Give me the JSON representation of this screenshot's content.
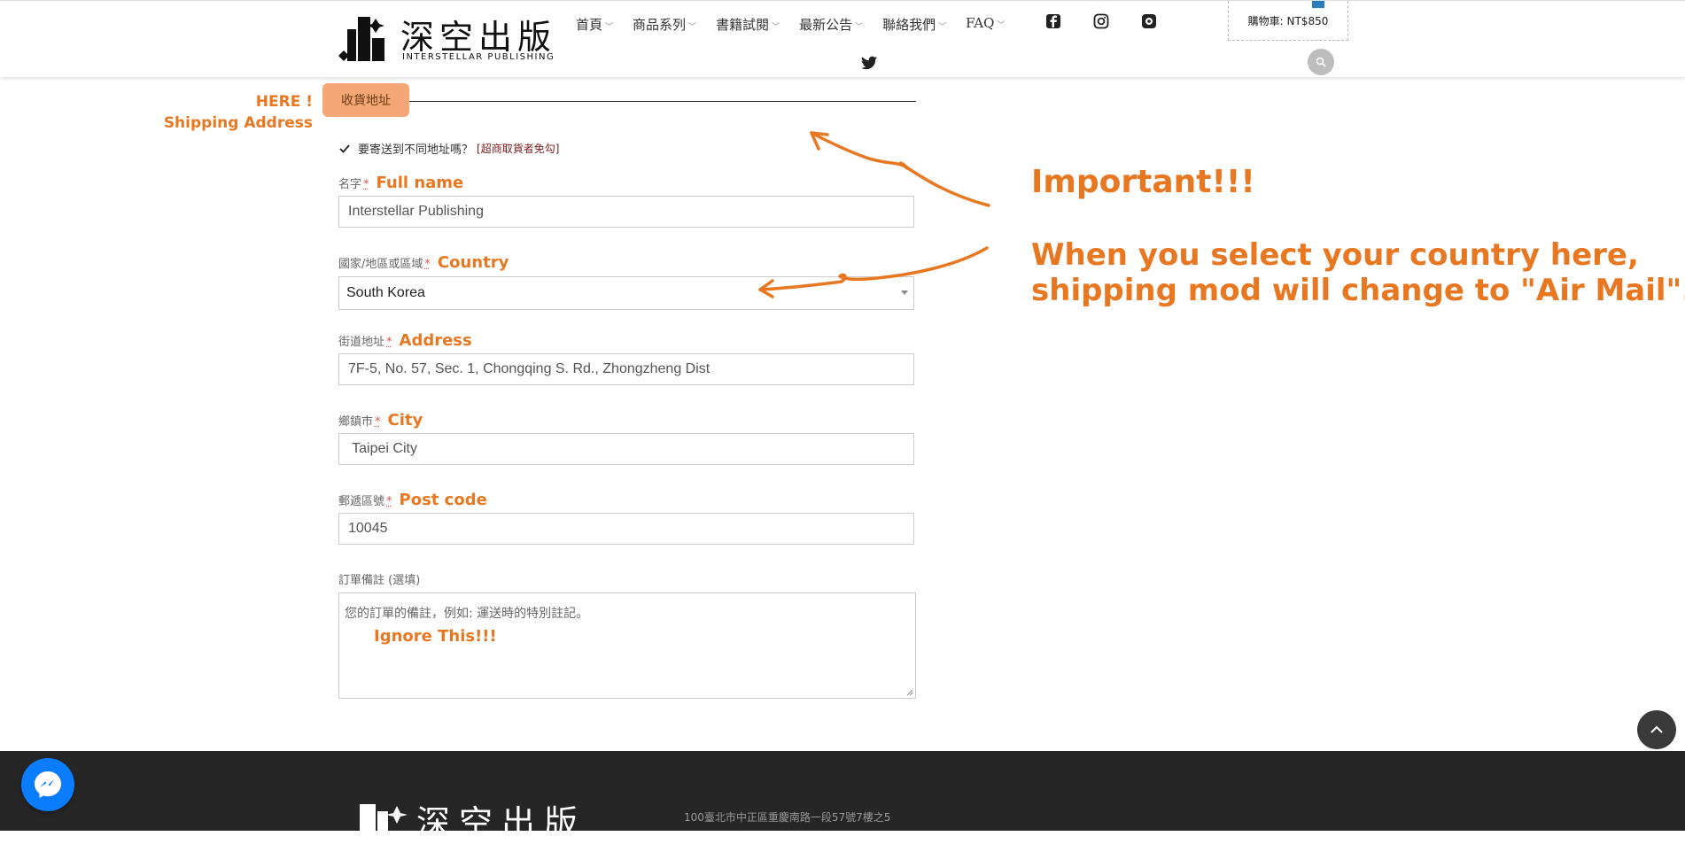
{
  "header": {
    "logo_cn": "深空出版",
    "logo_en": "INTERSTELLAR PUBLISHING",
    "nav": [
      {
        "label": "首頁"
      },
      {
        "label": "商品系列"
      },
      {
        "label": "書籍試閱"
      },
      {
        "label": "最新公告"
      },
      {
        "label": "聯絡我們"
      },
      {
        "label": "FAQ"
      }
    ],
    "social_icons": [
      "facebook-icon",
      "instagram-icon",
      "plurk-icon",
      "twitter-icon"
    ],
    "cart_label": "購物車: NT$850"
  },
  "section": {
    "title": "收貨地址",
    "ship_different_label": "要寄送到不同地址嗎？",
    "ship_different_checked": true,
    "ship_different_hint": "[超商取貨者免勾]"
  },
  "form": {
    "name": {
      "label": "名字",
      "en": "Full name",
      "value": "Interstellar Publishing"
    },
    "country": {
      "label": "國家/地區或區域",
      "en": "Country",
      "value": "South Korea"
    },
    "address": {
      "label": "街道地址",
      "en": "Address",
      "value": "7F-5, No. 57, Sec. 1, Chongqing S. Rd., Zhongzheng Dist"
    },
    "city": {
      "label": "鄉鎮市",
      "en": "City",
      "value": " Taipei City"
    },
    "postcode": {
      "label": "郵遞區號",
      "en": "Post code",
      "value": "10045"
    },
    "notes": {
      "label": "訂單備註 (選填)",
      "placeholder": "您的訂單的備註，例如: 運送時的特別註記。"
    },
    "required_mark": "*"
  },
  "annotations": {
    "here_line1": "HERE !",
    "here_line2": "Shipping Address",
    "important": "Important!!!",
    "note_line1": "When you select your country here,",
    "note_line2": "shipping mod will change to \"Air Mail\".",
    "ignore": "Ignore This!!!",
    "color": "#e87722"
  },
  "footer": {
    "logo_cn": "深空出版",
    "address": "100臺北市中正區重慶南路一段57號7樓之5"
  }
}
